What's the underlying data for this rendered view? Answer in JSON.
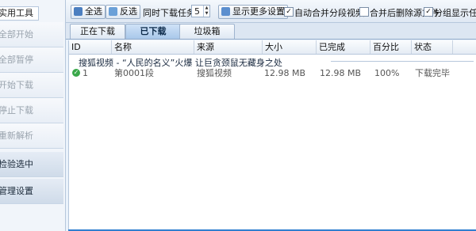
{
  "sidebar": {
    "tab_label": "实用工具",
    "items": [
      {
        "label": "全部开始",
        "active": false
      },
      {
        "label": "全部暂停",
        "active": false
      },
      {
        "label": "开始下载",
        "active": false
      },
      {
        "label": "停止下载",
        "active": false
      },
      {
        "label": "重新解析",
        "active": false
      },
      {
        "label": "检验选中",
        "active": true
      },
      {
        "label": "管理设置",
        "active": true
      }
    ]
  },
  "toolbar": {
    "select_all": "全选",
    "invert": "反选",
    "concurrent_label": "同时下载任务数:",
    "concurrent_value": "5",
    "more_settings": "显示更多设置",
    "auto_merge": {
      "label": "自动合并分段视频",
      "checked": true
    },
    "verify_after_merge": {
      "label": "合并后删除源文件",
      "checked": false
    },
    "group_display": {
      "label": "分组显示任务",
      "checked": true
    }
  },
  "tabs": [
    {
      "label": "正在下载",
      "active": false
    },
    {
      "label": "已下载",
      "active": true
    },
    {
      "label": "垃圾箱",
      "active": false
    }
  ],
  "columns": [
    "ID",
    "名称",
    "来源",
    "大小",
    "已完成",
    "百分比",
    "状态"
  ],
  "group_title": "搜狐视频 - “人民的名义”火爆 让巨贪颈鼠无藏身之处",
  "rows": [
    {
      "id": "1",
      "name": "第0001段",
      "source": "搜狐视频",
      "size": "12.98 MB",
      "done": "12.98 MB",
      "percent": "100%",
      "status": "下载完毕"
    }
  ],
  "colors": {
    "accent": "#2f7fd0",
    "ok": "#3aa84a"
  }
}
